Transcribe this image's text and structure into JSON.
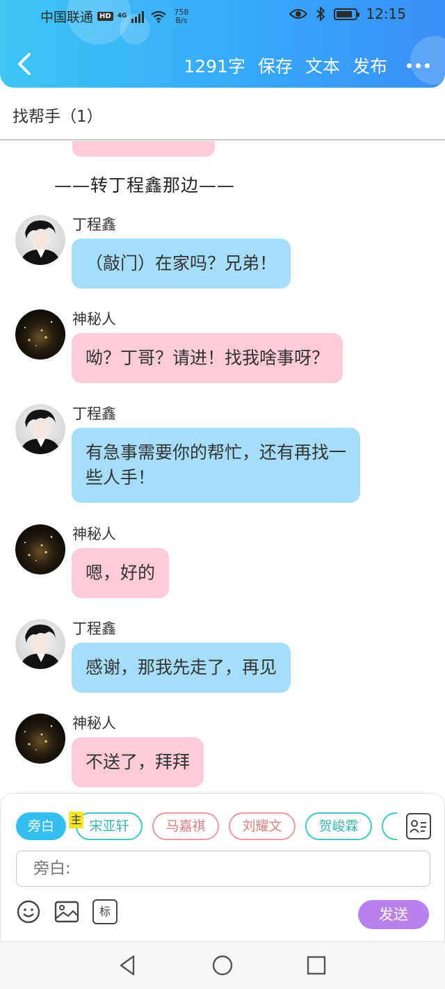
{
  "status_bar": {
    "carrier": "中国联通",
    "hd_badge": "HD",
    "network": "4G",
    "speed_value": "758",
    "speed_unit": "B/s",
    "time": "12:15"
  },
  "header": {
    "back_icon": "chevron-left-icon",
    "word_count": "1291字",
    "save_label": "保存",
    "text_label": "文本",
    "publish_label": "发布",
    "more_icon": "more-horizontal-icon",
    "colors": {
      "gradient_start": "#3ec6f4",
      "gradient_end": "#3a8ff6"
    }
  },
  "chat_title": "找帮手（1）",
  "narration": "——转丁程鑫那边——",
  "messages": [
    {
      "speaker": "丁程鑫",
      "avatar": "person-avatar",
      "color": "blue",
      "text": "（敲门）在家吗？兄弟！"
    },
    {
      "speaker": "神秘人",
      "avatar": "dark-sparkle-avatar",
      "color": "pink",
      "text": "呦？丁哥？请进！找我啥事呀？"
    },
    {
      "speaker": "丁程鑫",
      "avatar": "person-avatar",
      "color": "blue",
      "text_line1": "有急事需要你的帮忙，还有再找一",
      "text_line2": "些人手！"
    },
    {
      "speaker": "神秘人",
      "avatar": "dark-sparkle-avatar",
      "color": "pink",
      "text": "嗯，好的"
    },
    {
      "speaker": "丁程鑫",
      "avatar": "person-avatar",
      "color": "blue",
      "text": "感谢，那我先走了，再见"
    },
    {
      "speaker": "神秘人",
      "avatar": "dark-sparkle-avatar",
      "color": "pink",
      "text": "不送了，拜拜"
    }
  ],
  "input_panel": {
    "roles": [
      {
        "label": "旁白",
        "style": "active"
      },
      {
        "label": "宋亚轩",
        "style": "teal"
      },
      {
        "label": "马嘉祺",
        "style": "red"
      },
      {
        "label": "刘耀文",
        "style": "red"
      },
      {
        "label": "贺峻霖",
        "style": "teal"
      }
    ],
    "main_tag": "主",
    "input_placeholder": "旁白:",
    "emoji_icon": "smiley-icon",
    "image_icon": "image-icon",
    "tag_icon_label": "标",
    "send_label": "发送",
    "colors": {
      "active": "#35bef0",
      "send": "#b881eb",
      "blue_bubble": "#a6def9",
      "pink_bubble": "#fbcbd7"
    }
  },
  "nav_bar": {
    "back": "triangle-back-icon",
    "home": "circle-home-icon",
    "recent": "square-recent-icon"
  }
}
